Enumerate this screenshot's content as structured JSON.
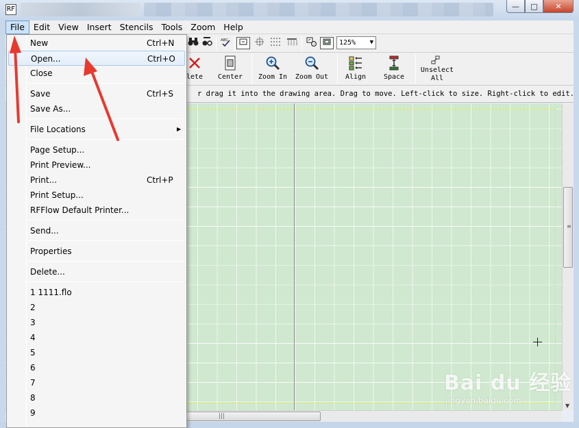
{
  "window": {
    "icon_text": "RF",
    "minimize_glyph": "—",
    "maximize_glyph": "□",
    "close_glyph": "✕"
  },
  "menubar": {
    "items": [
      "File",
      "Edit",
      "View",
      "Insert",
      "Stencils",
      "Tools",
      "Zoom",
      "Help"
    ],
    "active": "File"
  },
  "toolbar1": {
    "zoom_value": "125%",
    "zoom_arrow": "▼"
  },
  "toolbar2": {
    "delete_label_partial": "lete",
    "center_label": "Center",
    "zoom_in_label": "Zoom In",
    "zoom_out_label": "Zoom Out",
    "align_label": "Align",
    "space_label": "Space",
    "unselect_line1": "Unselect",
    "unselect_line2": "All"
  },
  "hint_text": "r drag it into the drawing area. Drag to move. Left-click to size. Right-click to edit.",
  "file_menu": {
    "new": {
      "label": "New",
      "shortcut": "Ctrl+N"
    },
    "open": {
      "label": "Open...",
      "shortcut": "Ctrl+O"
    },
    "close": {
      "label": "Close"
    },
    "save": {
      "label": "Save",
      "shortcut": "Ctrl+S"
    },
    "save_as": {
      "label": "Save As..."
    },
    "file_locations": {
      "label": "File Locations",
      "submenu_glyph": "▶"
    },
    "page_setup": {
      "label": "Page Setup..."
    },
    "print_preview": {
      "label": "Print Preview..."
    },
    "print": {
      "label": "Print...",
      "shortcut": "Ctrl+P"
    },
    "print_setup": {
      "label": "Print Setup..."
    },
    "default_printer": {
      "label": "RFFlow Default Printer..."
    },
    "send": {
      "label": "Send..."
    },
    "properties": {
      "label": "Properties"
    },
    "delete": {
      "label": "Delete..."
    },
    "recent": [
      "1 1111.flo",
      "2",
      "3",
      "4",
      "5",
      "6",
      "7",
      "8",
      "9"
    ]
  },
  "watermark": {
    "brand": "Bai du 经验",
    "url": "jingyan.baidu.com"
  },
  "colors": {
    "canvas": "#cfe8cf",
    "arrow": "#e8392f",
    "menu_highlight": "#cde3f7"
  }
}
